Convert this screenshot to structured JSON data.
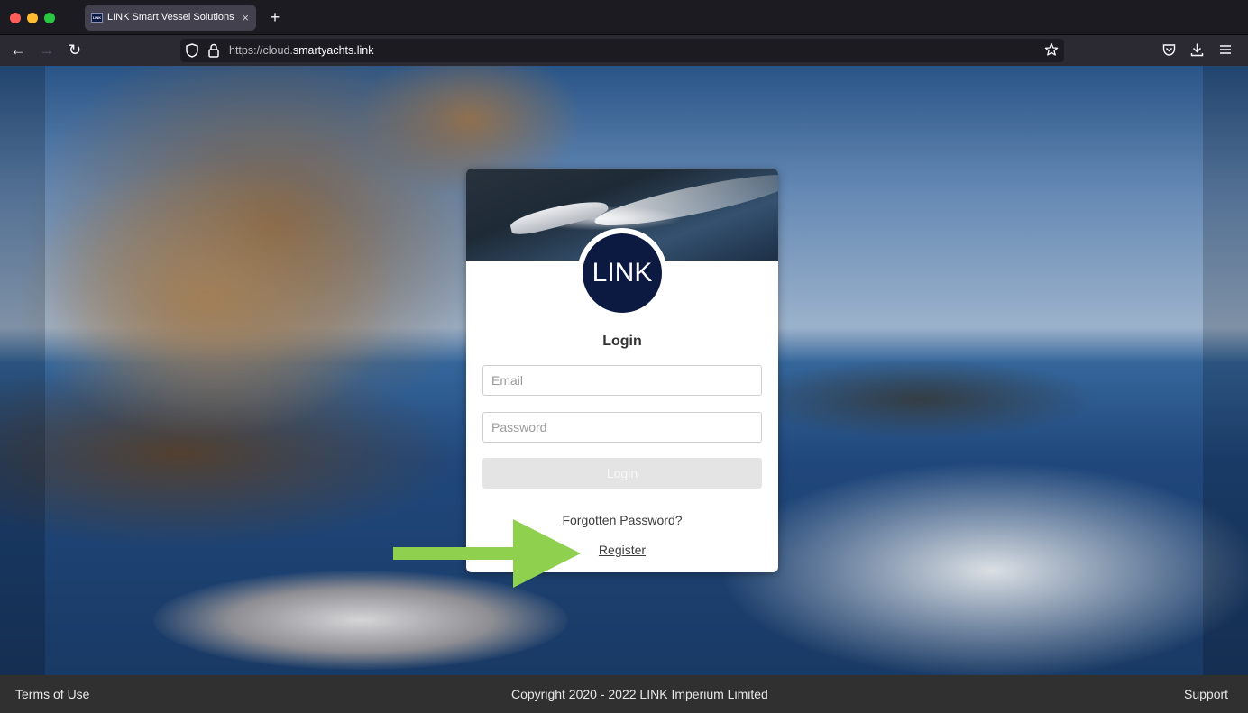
{
  "browser": {
    "tab_title": "LINK Smart Vessel Solutions",
    "favicon_text": "LINK",
    "new_tab_symbol": "+",
    "close_tab_symbol": "×",
    "url_prefix": "https://cloud.",
    "url_domain": "smartyachts.link",
    "url_suffix": "",
    "icons": [
      "back-icon",
      "forward-icon",
      "reload-icon",
      "shield-icon",
      "lock-icon",
      "bookmark-star-icon",
      "pocket-icon",
      "download-icon",
      "menu-icon"
    ]
  },
  "login": {
    "logo_text": "LINK",
    "title": "Login",
    "email_placeholder": "Email",
    "password_placeholder": "Password",
    "login_button": "Login",
    "forgot_link": "Forgotten Password?",
    "register_link": "Register"
  },
  "annotation": {
    "arrow_color": "#8fd14f",
    "points_to": "Register"
  },
  "footer": {
    "terms": "Terms of Use",
    "copyright": "Copyright 2020 - 2022 LINK Imperium Limited",
    "support": "Support"
  },
  "colors": {
    "logo_bg": "#0c1a42",
    "footer_bg": "#303030",
    "browser_chrome": "#1c1b22"
  }
}
